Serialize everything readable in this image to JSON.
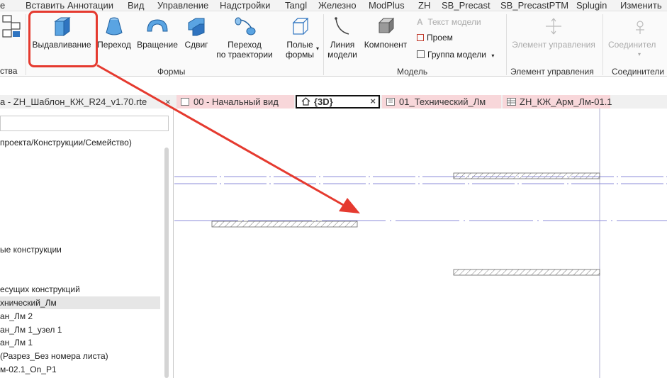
{
  "menu": {
    "items": [
      "е",
      "Вставить",
      "Аннотации",
      "Вид",
      "Управление",
      "Надстройки",
      "Tangl",
      "Железно",
      "ModPlus",
      "ZH",
      "SB_Precast",
      "SB_PrecastPTM",
      "Splugin",
      "Изменить"
    ]
  },
  "ribbon": {
    "left_partial_label": "ства",
    "forms": {
      "extrusion": "Выдавливание",
      "blend": "Переход",
      "revolve": "Вращение",
      "sweep": "Сдвиг",
      "sweep_blend_line1": "Переход",
      "sweep_blend_line2": "по траектории",
      "void_line1": "Полые",
      "void_line2": "формы",
      "panel_label": "Формы"
    },
    "model": {
      "model_line_line1": "Линия",
      "model_line_line2": "модели",
      "component": "Компонент",
      "model_text": "Текст модели",
      "opening": "Проем",
      "model_group": "Группа модели",
      "panel_label": "Модель"
    },
    "control": {
      "control_button": "Элемент управления",
      "panel_label": "Элемент управления"
    },
    "connector": {
      "connector_button": "Соединител",
      "panel_label": "Соединители"
    }
  },
  "tabs": {
    "project_title": "а - ZH_Шаблон_КЖ_R24_v1.70.rte",
    "items": [
      {
        "label": "00 - Начальный вид"
      },
      {
        "label": "{3D}"
      },
      {
        "label": "01_Технический_Лм"
      },
      {
        "label": "ZH_КЖ_Арм_Лм-01.1"
      }
    ],
    "close_symbol": "×"
  },
  "browser": {
    "search_placeholder": "",
    "items": [
      {
        "label": "проекта/Конструкции/Семейство)"
      },
      {
        "label": "ые конструкции"
      },
      {
        "label": "есущих конструкций"
      },
      {
        "label": "хнический_Лм"
      },
      {
        "label": "ан_Лм 2"
      },
      {
        "label": "ан_Лм 1_узел 1"
      },
      {
        "label": "ан_Лм 1"
      },
      {
        "label": "(Разрез_Без номера листа)"
      },
      {
        "label": "м-02.1_On_P1"
      }
    ]
  },
  "colors": {
    "annotation_red": "#e53a2f",
    "tab_inactive": "#f8d7da",
    "ref_line": "#8b8bd8",
    "hatch": "#777777"
  }
}
